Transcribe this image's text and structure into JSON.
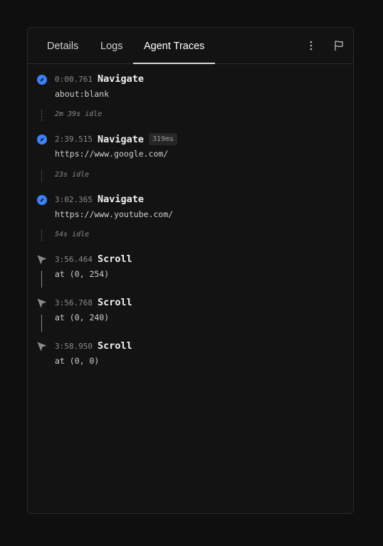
{
  "tabs": [
    {
      "label": "Details",
      "active": false
    },
    {
      "label": "Logs",
      "active": false
    },
    {
      "label": "Agent Traces",
      "active": true
    }
  ],
  "header_icons": [
    "more-vertical-icon",
    "flag-icon"
  ],
  "colors": {
    "navigate_icon": "#3b82f6",
    "scroll_icon": "#8a8a8a"
  },
  "events": [
    {
      "time": "0:00.761",
      "action": "Navigate",
      "detail": "about:blank",
      "icon": "compass-icon"
    },
    {
      "idle": "2m 39s idle"
    },
    {
      "time": "2:39.515",
      "action": "Navigate",
      "badge": "319ms",
      "detail": "https://www.google.com/",
      "icon": "compass-icon"
    },
    {
      "idle": "23s idle"
    },
    {
      "time": "3:02.365",
      "action": "Navigate",
      "detail": "https://www.youtube.com/",
      "icon": "compass-icon"
    },
    {
      "idle": "54s idle"
    },
    {
      "time": "3:56.464",
      "action": "Scroll",
      "detail": "at (0, 254)",
      "icon": "cursor-arrow-icon"
    },
    {
      "time": "3:56.768",
      "action": "Scroll",
      "detail": "at (0, 240)",
      "icon": "cursor-arrow-icon"
    },
    {
      "time": "3:58.950",
      "action": "Scroll",
      "detail": "at (0, 0)",
      "icon": "cursor-arrow-icon"
    }
  ]
}
